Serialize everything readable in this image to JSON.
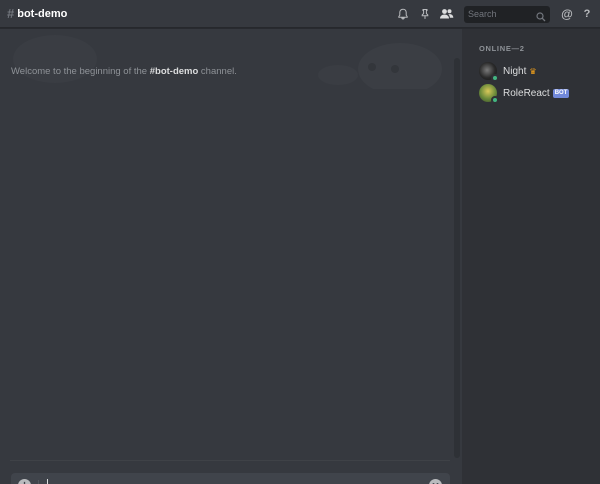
{
  "header": {
    "hash": "#",
    "channel": "bot-demo",
    "search_placeholder": "Search"
  },
  "icons": {
    "bell": "bell-icon",
    "pin": "pin-icon",
    "members": "members-icon",
    "search": "search-icon",
    "mention": "@",
    "help": "?"
  },
  "chat": {
    "welcome_prefix": "Welcome to the beginning of the ",
    "welcome_channel": "#bot-demo",
    "welcome_suffix": " channel.",
    "composer_add": "+"
  },
  "members": {
    "header": "ONLINE—2",
    "list": [
      {
        "name": "Night",
        "badge": "♛",
        "status": "online"
      },
      {
        "name": "RoleReact",
        "badge": "BOT",
        "status": "online"
      }
    ]
  },
  "colors": {
    "background": "#36393f",
    "sidebar": "#2f3136",
    "input": "#40444b",
    "online": "#43b581",
    "bot_tag": "#7289da",
    "crown": "#faa61a"
  }
}
